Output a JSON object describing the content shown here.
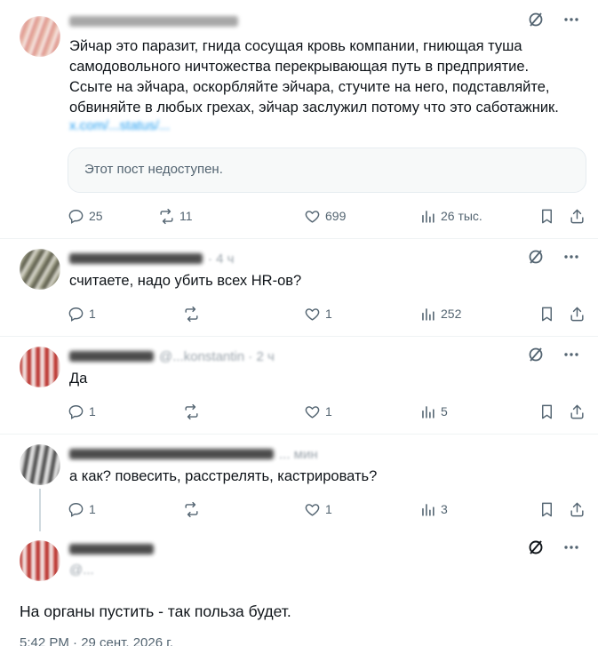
{
  "posts": [
    {
      "text": "Эйчар это паразит, гнида сосущая кровь компании, гниющая туша самодовольного ничтожества перекрывающая путь в предприятие. Ссыте на эйчара, оскорбляйте эйчара, стучите на него, подставляйте, обвиняйте в любых грехах, эйчар заслужил потому что это саботажник.",
      "link_fragment": "x.com/...status/...",
      "quote_unavailable": "Этот пост недоступен.",
      "replies": "25",
      "reposts": "11",
      "likes": "699",
      "views": "26 тыс."
    },
    {
      "handle_fragment": "· 4 ч",
      "text": "считаете, надо убить всех HR-ов?",
      "replies": "1",
      "reposts": "",
      "likes": "1",
      "views": "252"
    },
    {
      "handle_fragment": "@...konstantin · 2 ч",
      "text": "Да",
      "replies": "1",
      "reposts": "",
      "likes": "1",
      "views": "5"
    },
    {
      "handle_fragment": "... мин",
      "text": "а как? повесить, расстрелять, кастрировать?",
      "replies": "1",
      "reposts": "",
      "likes": "1",
      "views": "3"
    }
  ],
  "main_post": {
    "handle_fragment": "@...",
    "text": "На органы пустить - так польза будет.",
    "timestamp": "5:42 PM · 29 сент. 2026 г."
  },
  "icons": [
    "grok-icon",
    "more-icon",
    "reply-icon",
    "repost-icon",
    "like-icon",
    "views-icon",
    "bookmark-icon",
    "share-icon"
  ],
  "colors": {
    "text": "#0f1419",
    "secondary": "#536471",
    "divider": "#eff3f4",
    "quote_bg": "#f7f9f9"
  }
}
